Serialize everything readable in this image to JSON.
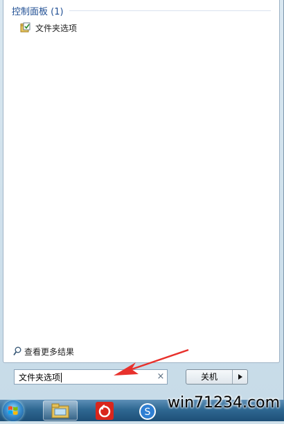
{
  "start_menu": {
    "section": {
      "title": "控制面板 (1)"
    },
    "results": [
      {
        "label": "文件夹选项",
        "icon": "folder-options-icon"
      }
    ],
    "see_more": {
      "label": "查看更多结果",
      "icon": "search-icon"
    },
    "search": {
      "value": "文件夹选项",
      "clear_icon": "×"
    },
    "shutdown": {
      "label": "关机",
      "arrow_icon": "chevron-right-icon"
    }
  },
  "taskbar": {
    "items": [
      {
        "name": "start-orb",
        "icon": "windows-logo-icon"
      },
      {
        "name": "explorer",
        "icon": "folder-icon"
      },
      {
        "name": "netease-music",
        "icon": "netease-music-icon"
      },
      {
        "name": "sogou",
        "icon": "sogou-icon"
      }
    ]
  },
  "watermark": "win71234.com",
  "colors": {
    "section_title": "#1f4e93",
    "annotation_arrow": "#e8312c",
    "taskbar": "#2f6892"
  }
}
